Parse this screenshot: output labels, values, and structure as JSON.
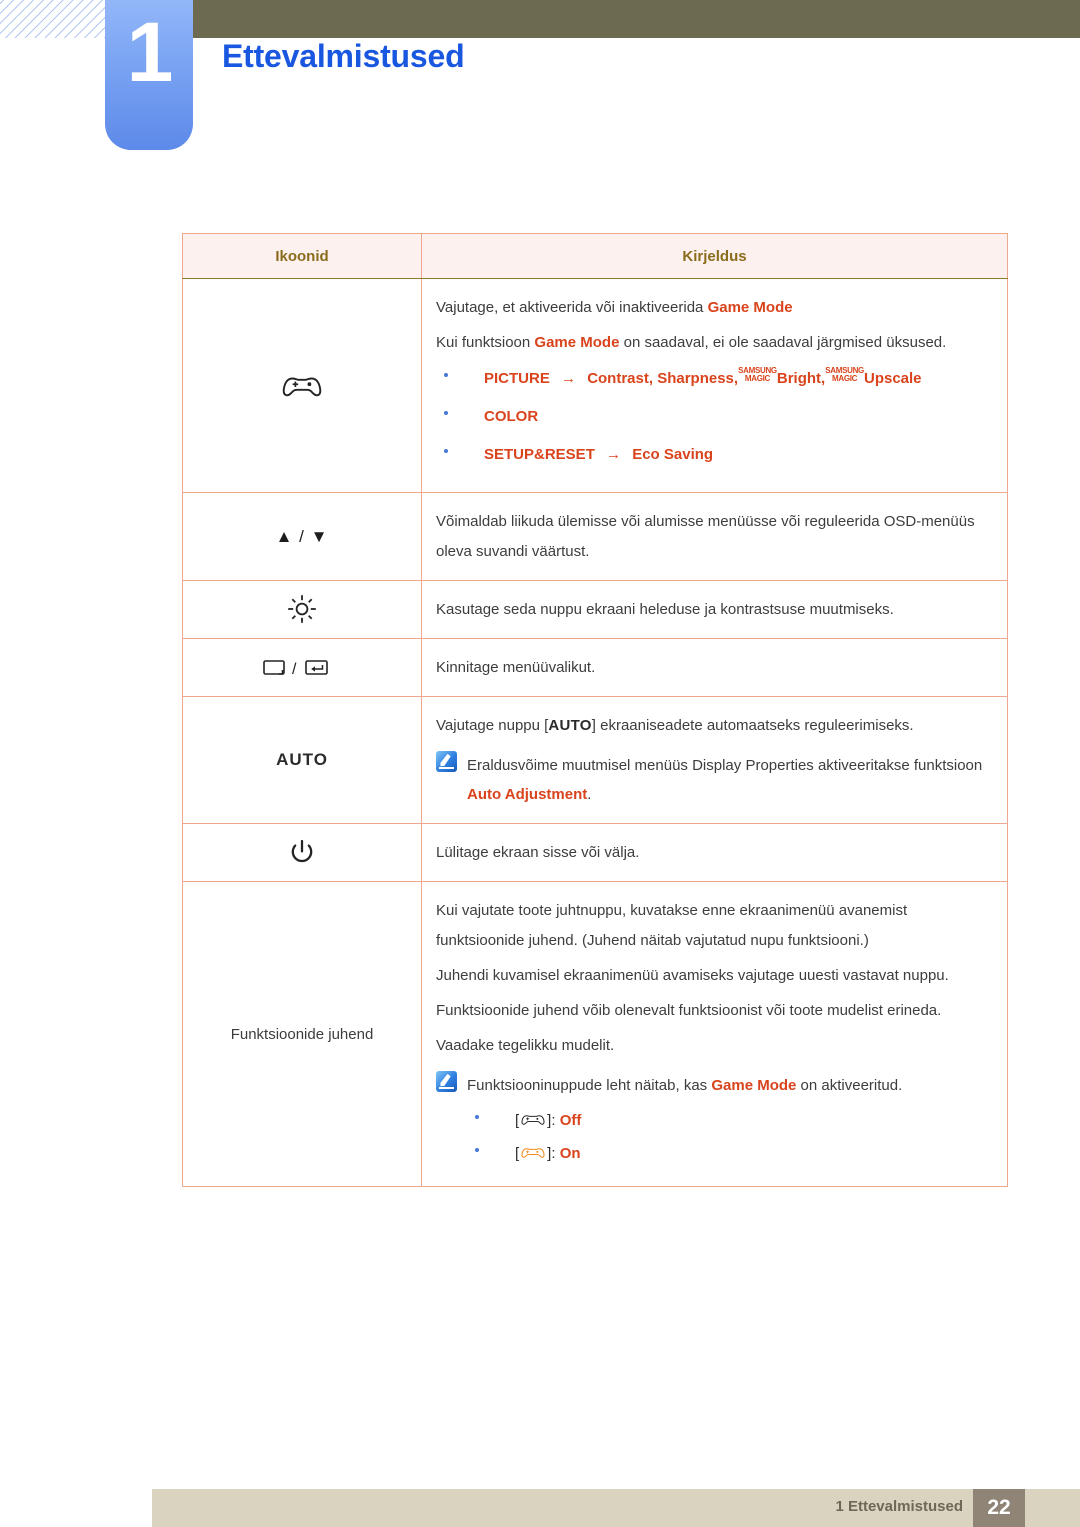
{
  "header": {
    "chapter_number": "1",
    "chapter_title": "Ettevalmistused"
  },
  "table": {
    "columns": [
      "Ikoonid",
      "Kirjeldus"
    ],
    "rows": [
      {
        "icon_name": "gamepad-icon",
        "icon_label": "",
        "lines": [
          "Vajutage, et aktiveerida või inaktiveerida ",
          "Kui funktsioon ",
          " on saadaval, ei ole saadaval järgmised üksused."
        ],
        "line1_prefix": "Vajutage, et aktiveerida või inaktiveerida",
        "line1_highlight": "Game Mode",
        "line2_prefix": "Kui funktsioon",
        "line2_highlight": "Game Mode",
        "line2_suffix": "on saadaval, ei ole saadaval järgmised üksused.",
        "bullets": [
          {
            "menu": "PICTURE",
            "arrow": "→",
            "items": "Contrast, Sharpness,",
            "magic1_top": "SAMSUNG",
            "magic1_bottom": "MAGIC",
            "magic1_word": "Bright,",
            "magic2_top": "SAMSUNG",
            "magic2_bottom": "MAGIC",
            "magic2_word": "Upscale"
          },
          {
            "menu": "COLOR"
          },
          {
            "menu": "SETUP&RESET",
            "arrow": "→",
            "items": "Eco Saving"
          }
        ]
      },
      {
        "icon_name": "up-down-arrows-icon",
        "icon_label": "▲ / ▼",
        "line1": "Võimaldab liikuda ülemisse või alumisse menüüsse või reguleerida OSD-menüüs oleva suvandi väärtust."
      },
      {
        "icon_name": "brightness-icon",
        "icon_label": "",
        "line1": "Kasutage seda nuppu ekraani heleduse ja kontrastsuse muutmiseks."
      },
      {
        "icon_name": "menu-enter-icon",
        "icon_label": "",
        "line1": "Kinnitage menüüvalikut."
      },
      {
        "icon_name": "auto-button-icon",
        "icon_label": "AUTO",
        "line1_prefix": "Vajutage nuppu [",
        "line1_key": "AUTO",
        "line1_suffix": "] ekraaniseadete automaatseks reguleerimiseks.",
        "note_prefix": "Eraldusvõime muutmisel menüüs Display Properties aktiveeritakse funktsioon",
        "note_highlight": "Auto Adjustment",
        "note_suffix": "."
      },
      {
        "icon_name": "power-icon",
        "icon_label": "",
        "line1": "Lülitage ekraan sisse või välja."
      },
      {
        "icon_name": "function-guide-label",
        "icon_label": "Funktsioonide juhend",
        "paragraphs": [
          "Kui vajutate toote juhtnuppu, kuvatakse enne ekraanimenüü avanemist funktsioonide juhend. (Juhend näitab vajutatud nupu funktsiooni.)",
          "Juhendi kuvamisel ekraanimenüü avamiseks vajutage uuesti vastavat nuppu.",
          "Funktsioonide juhend võib olenevalt funktsioonist või toote mudelist erineda.",
          "Vaadake tegelikku mudelit."
        ],
        "note_prefix": "Funktsiooninuppude leht näitab, kas",
        "note_highlight": "Game Mode",
        "note_suffix": "on aktiveeritud.",
        "states": [
          {
            "bracket_open": "[",
            "bracket_close": "]:",
            "state": "Off",
            "icon_name": "gamepad-off-icon",
            "color": "#2b2b2b"
          },
          {
            "bracket_open": "[",
            "bracket_close": "]:",
            "state": "On",
            "icon_name": "gamepad-on-icon",
            "color": "#f08a1c"
          }
        ]
      }
    ]
  },
  "footer": {
    "text": "1 Ettevalmistused",
    "page_number": "22"
  },
  "colors": {
    "accent_orange": "#d9441d",
    "title_blue": "#1a57e0",
    "table_border": "#8a7a25",
    "inner_border": "#eda98e",
    "header_bg": "#fdf1ef",
    "header_text": "#8a6d1c",
    "olive_bar": "#6d6a52",
    "footer_bar": "#d9d3bf",
    "page_box": "#8f8475",
    "game_on_orange": "#f08a1c"
  }
}
